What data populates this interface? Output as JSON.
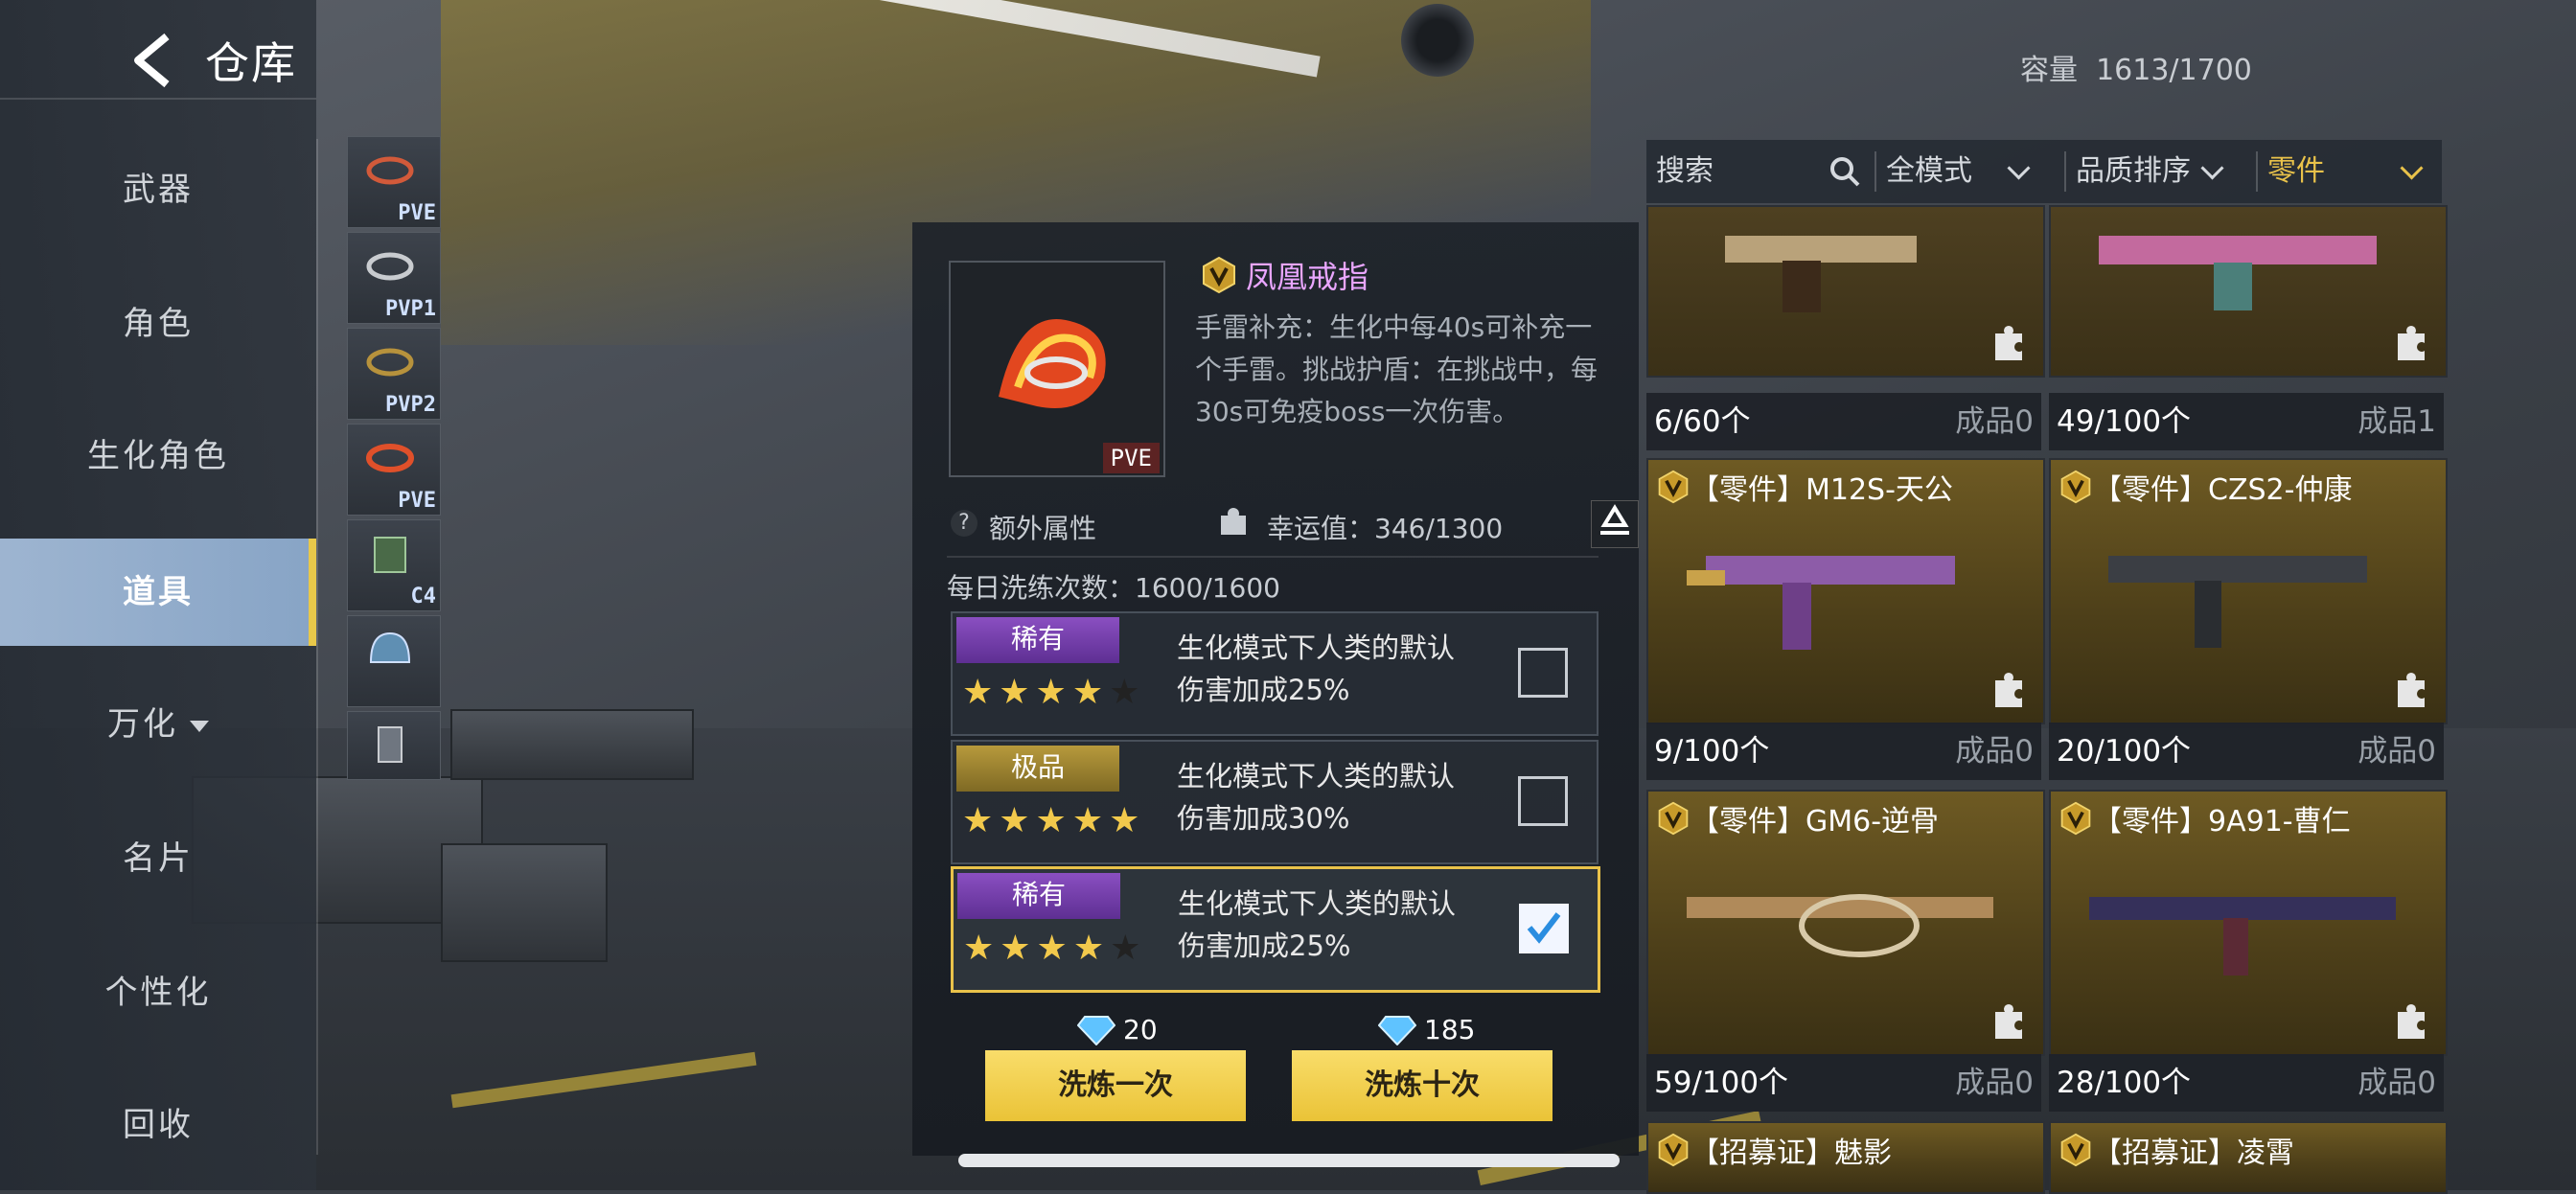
{
  "header": {
    "title": "仓库",
    "capacity_label": "容量",
    "capacity_value": "1613/1700"
  },
  "nav": {
    "items": [
      {
        "label": "武器"
      },
      {
        "label": "角色"
      },
      {
        "label": "生化角色"
      },
      {
        "label": "道具",
        "active": true
      },
      {
        "label": "万化",
        "has_dropdown": true
      },
      {
        "label": "名片"
      },
      {
        "label": "个性化"
      },
      {
        "label": "回收"
      }
    ]
  },
  "thumbs": [
    {
      "label": "PVE"
    },
    {
      "label": "PVP1"
    },
    {
      "label": "PVP2"
    },
    {
      "label": "PVE"
    },
    {
      "label": "C4"
    },
    {
      "label": ""
    },
    {
      "label": ""
    }
  ],
  "detail": {
    "badge": "PVE",
    "name": "凤凰戒指",
    "desc": "手雷补充：生化中每40s可补充一个手雷。挑战护盾：在挑战中，每30s可免疫boss一次伤害。",
    "extra_attr": "额外属性",
    "luck_label": "幸运值：346/1300",
    "daily": "每日洗练次数：1600/1600",
    "options": [
      {
        "rarity": "稀有",
        "rarity_color": "#7a43b3",
        "stars": 4,
        "text_line1": "生化模式下人类的默认",
        "text_line2": "伤害加成25%",
        "checked": false
      },
      {
        "rarity": "极品",
        "rarity_color": "#a58a34",
        "stars": 5,
        "text_line1": "生化模式下人类的默认",
        "text_line2": "伤害加成30%",
        "checked": false
      },
      {
        "rarity": "稀有",
        "rarity_color": "#7a43b3",
        "stars": 4,
        "text_line1": "生化模式下人类的默认",
        "text_line2": "伤害加成25%",
        "checked": true
      }
    ],
    "cost_once": "20",
    "cost_ten": "185",
    "btn_once": "洗炼一次",
    "btn_ten": "洗炼十次"
  },
  "toolbar": {
    "search_placeholder": "搜索",
    "mode": "全模式",
    "sort": "品质排序",
    "category": "零件"
  },
  "grid": {
    "top_row": [
      {
        "count": "6/60个",
        "finished": "成品0"
      },
      {
        "count": "49/100个",
        "finished": "成品1"
      }
    ],
    "rows": [
      [
        {
          "name": "【零件】M12S-天公",
          "count": "9/100个",
          "finished": "成品0"
        },
        {
          "name": "【零件】CZS2-仲康",
          "count": "20/100个",
          "finished": "成品0"
        }
      ],
      [
        {
          "name": "【零件】GM6-逆骨",
          "count": "59/100个",
          "finished": "成品0"
        },
        {
          "name": "【零件】9A91-曹仁",
          "count": "28/100个",
          "finished": "成品0"
        }
      ]
    ],
    "bottom_row": [
      {
        "name": "【招募证】魅影"
      },
      {
        "name": "【招募证】凌霄"
      }
    ]
  },
  "colors": {
    "accent_gold": "#e9c24a",
    "rare_purple": "#7a43b3",
    "epic_gold": "#a58a34"
  }
}
